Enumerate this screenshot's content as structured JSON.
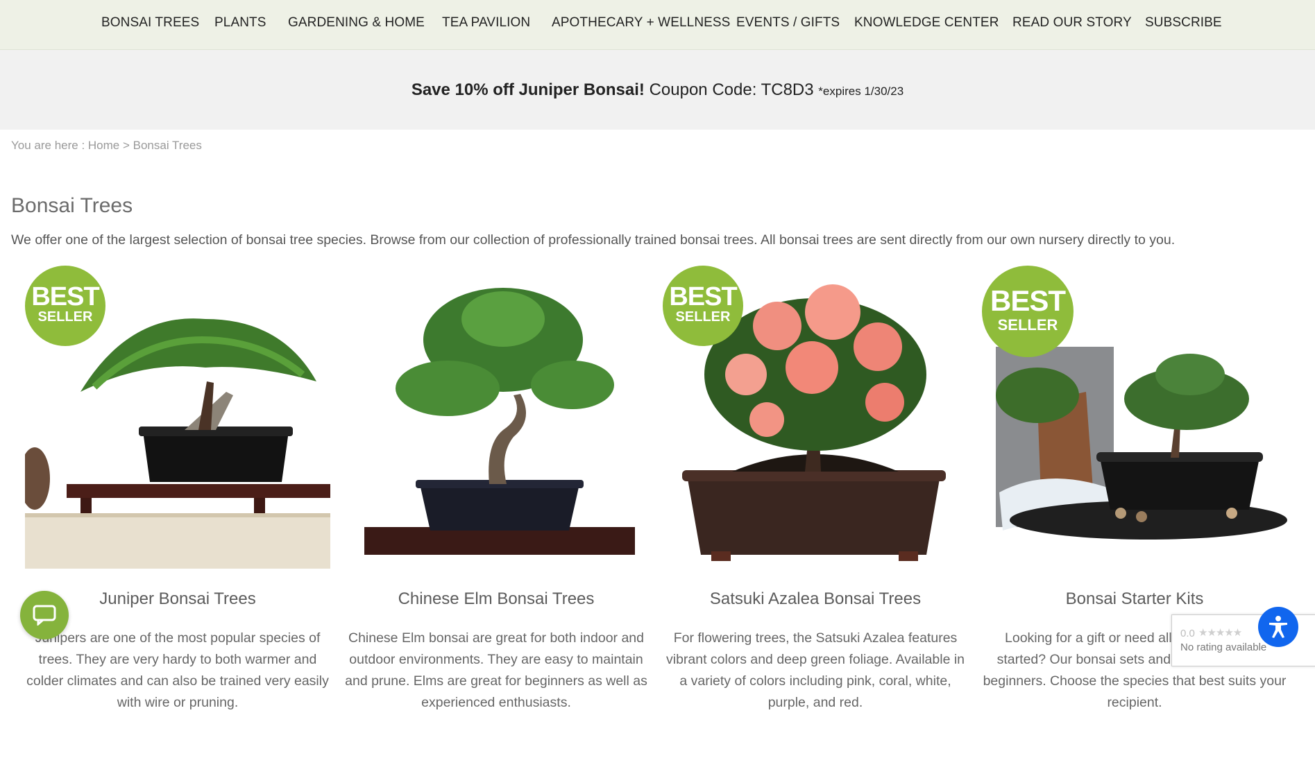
{
  "nav": {
    "items": [
      {
        "label": "BONSAI TREES"
      },
      {
        "label": "PLANTS"
      },
      {
        "label": "GARDENING & HOME"
      },
      {
        "label": "TEA PAVILION"
      },
      {
        "label": "APOTHECARY + WELLNESS"
      },
      {
        "label": "EVENTS / GIFTS"
      },
      {
        "label": "KNOWLEDGE CENTER"
      },
      {
        "label": "READ OUR STORY"
      },
      {
        "label": "SUBSCRIBE"
      }
    ]
  },
  "promo": {
    "headline": "Save 10% off Juniper Bonsai!",
    "coupon": "Coupon Code: TC8D3",
    "expires": "*expires 1/30/23"
  },
  "breadcrumb": {
    "prefix": "You are here : ",
    "home": "Home",
    "separator": " > ",
    "current": "Bonsai Trees"
  },
  "page": {
    "title": "Bonsai Trees",
    "intro": "We offer one of the largest selection of bonsai tree species. Browse from our collection of professionally trained bonsai trees. All bonsai trees are sent directly from our own nursery directly to you."
  },
  "badge": {
    "line1": "BEST",
    "line2": "SELLER"
  },
  "products": [
    {
      "title": "Juniper Bonsai Trees",
      "description": "Junipers are one of the most popular species of trees. They are very hardy to both warmer and colder climates and can also be trained very easily with wire or pruning.",
      "best_seller": true
    },
    {
      "title": "Chinese Elm Bonsai Trees",
      "description": "Chinese Elm bonsai are great for both indoor and outdoor environments. They are easy to maintain and prune. Elms are great for beginners as well as experienced enthusiasts.",
      "best_seller": false
    },
    {
      "title": "Satsuki Azalea Bonsai Trees",
      "description": "For flowering trees, the Satsuki Azalea features vibrant colors and deep green foliage. Available in a variety of colors including pink, coral, white, purple, and red.",
      "best_seller": true
    },
    {
      "title": "Bonsai Starter Kits",
      "description": "Looking for a gift or need all the tools to get started? Our bonsai sets and kits are great for beginners. Choose the species that best suits your recipient.",
      "best_seller": true
    }
  ],
  "rating_widget": {
    "score": "0.0",
    "stars": "★★★★★",
    "text": "No rating available"
  },
  "colors": {
    "accent_green": "#8fbc3b",
    "nav_bg": "#eef1e6",
    "promo_bg": "#f1f1f1",
    "accessibility_blue": "#1166ee"
  },
  "icons": {
    "chat": "chat-bubble-icon",
    "accessibility": "accessibility-person-icon"
  }
}
